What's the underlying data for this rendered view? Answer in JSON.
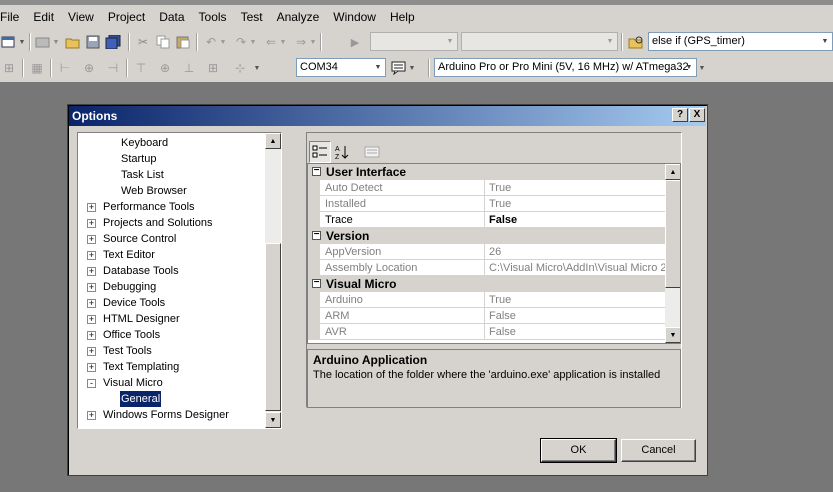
{
  "menubar": [
    "File",
    "Edit",
    "View",
    "Project",
    "Data",
    "Tools",
    "Test",
    "Analyze",
    "Window",
    "Help"
  ],
  "toolbar1": {
    "config_combo": "",
    "platform_combo": "",
    "find_combo": "else if (GPS_timer)"
  },
  "toolbar2": {
    "port_combo": "COM34",
    "board_combo": "Arduino Pro or Pro Mini (5V, 16 MHz) w/ ATmega32"
  },
  "dialog": {
    "title": "Options",
    "help_glyph": "?",
    "close_glyph": "X",
    "tree": [
      {
        "label": "Keyboard",
        "child": true
      },
      {
        "label": "Startup",
        "child": true
      },
      {
        "label": "Task List",
        "child": true
      },
      {
        "label": "Web Browser",
        "child": true
      },
      {
        "label": "Performance Tools",
        "expander": "+"
      },
      {
        "label": "Projects and Solutions",
        "expander": "+"
      },
      {
        "label": "Source Control",
        "expander": "+"
      },
      {
        "label": "Text Editor",
        "expander": "+"
      },
      {
        "label": "Database Tools",
        "expander": "+"
      },
      {
        "label": "Debugging",
        "expander": "+"
      },
      {
        "label": "Device Tools",
        "expander": "+"
      },
      {
        "label": "HTML Designer",
        "expander": "+"
      },
      {
        "label": "Office Tools",
        "expander": "+"
      },
      {
        "label": "Test Tools",
        "expander": "+"
      },
      {
        "label": "Text Templating",
        "expander": "+"
      },
      {
        "label": "Visual Micro",
        "expander": "-"
      },
      {
        "label": "General",
        "child": true,
        "selected": true
      },
      {
        "label": "Windows Forms Designer",
        "expander": "+"
      }
    ],
    "grid": [
      {
        "type": "cat",
        "label": "User Interface"
      },
      {
        "type": "prop",
        "name": "Auto Detect",
        "value": "True",
        "readonly": true
      },
      {
        "type": "prop",
        "name": "Installed",
        "value": "True",
        "readonly": true
      },
      {
        "type": "prop",
        "name": "Trace",
        "value": "False",
        "readonly": false,
        "bold": true
      },
      {
        "type": "cat",
        "label": "Version"
      },
      {
        "type": "prop",
        "name": "AppVersion",
        "value": "26",
        "readonly": true
      },
      {
        "type": "prop",
        "name": "Assembly Location",
        "value": "C:\\Visual Micro\\AddIn\\Visual Micro 2",
        "readonly": true
      },
      {
        "type": "cat",
        "label": "Visual Micro"
      },
      {
        "type": "prop",
        "name": "Arduino",
        "value": "True",
        "readonly": true
      },
      {
        "type": "prop",
        "name": "ARM",
        "value": "False",
        "readonly": true
      },
      {
        "type": "prop",
        "name": "AVR",
        "value": "False",
        "readonly": true
      }
    ],
    "description": {
      "title": "Arduino Application",
      "text": "The location of the folder where the 'arduino.exe' application is installed"
    },
    "ok_label": "OK",
    "cancel_label": "Cancel"
  },
  "colors": {
    "title_gradient_start": "#0a246a",
    "title_gradient_end": "#a6caf0",
    "selection": "#0a246a",
    "face": "#d6d3ce",
    "desktop": "#777777"
  }
}
